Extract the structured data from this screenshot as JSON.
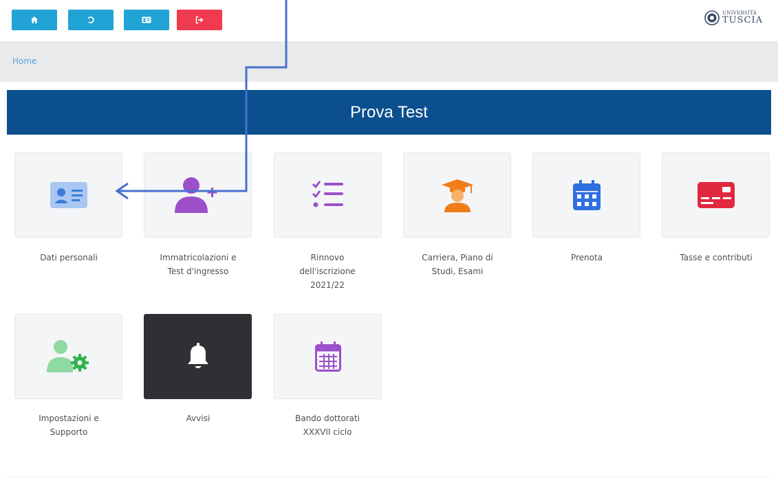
{
  "topbar": {
    "buttons": [
      {
        "name": "home",
        "icon": "home-icon",
        "color": "#21a3d6"
      },
      {
        "name": "back",
        "icon": "history-icon",
        "color": "#21a3d6"
      },
      {
        "name": "card",
        "icon": "id-card-icon",
        "color": "#21a3d6"
      },
      {
        "name": "logout",
        "icon": "logout-icon",
        "color": "#ef3a4f"
      }
    ],
    "logo": {
      "line1": "UNIVERSITÀ",
      "line2": "TUSCIA"
    }
  },
  "breadcrumb": {
    "home": "Home"
  },
  "banner": {
    "title": "Prova Test",
    "color": "#0b4f8f"
  },
  "tiles": [
    {
      "label_lines": [
        "Dati personali"
      ],
      "icon": "id-card-icon",
      "color": "#3b7dd8"
    },
    {
      "label_lines": [
        "Immatricolazioni e",
        "Test d'ingresso"
      ],
      "icon": "user-plus-icon",
      "color": "#9b4fc9"
    },
    {
      "label_lines": [
        "Rinnovo",
        "dell'iscrizione",
        "2021/22"
      ],
      "icon": "checklist-icon",
      "color": "#9b4fc9"
    },
    {
      "label_lines": [
        "Carriera, Piano di",
        "Studi, Esami"
      ],
      "icon": "graduate-icon",
      "color": "#f07d1a"
    },
    {
      "label_lines": [
        "Prenota"
      ],
      "icon": "calendar-icon",
      "color": "#2f6fe0"
    },
    {
      "label_lines": [
        "Tasse e contributi"
      ],
      "icon": "payment-card-icon",
      "color": "#e0283f"
    },
    {
      "label_lines": [
        "Impostazioni e",
        "Supporto"
      ],
      "icon": "user-gear-icon",
      "color": "#2fb24c"
    },
    {
      "label_lines": [
        "Avvisi"
      ],
      "icon": "bell-icon",
      "color": "#ffffff"
    },
    {
      "label_lines": [
        "Bando dottorati",
        "XXXVII ciclo"
      ],
      "icon": "calendar-grid-icon",
      "color": "#9b4fc9"
    }
  ]
}
